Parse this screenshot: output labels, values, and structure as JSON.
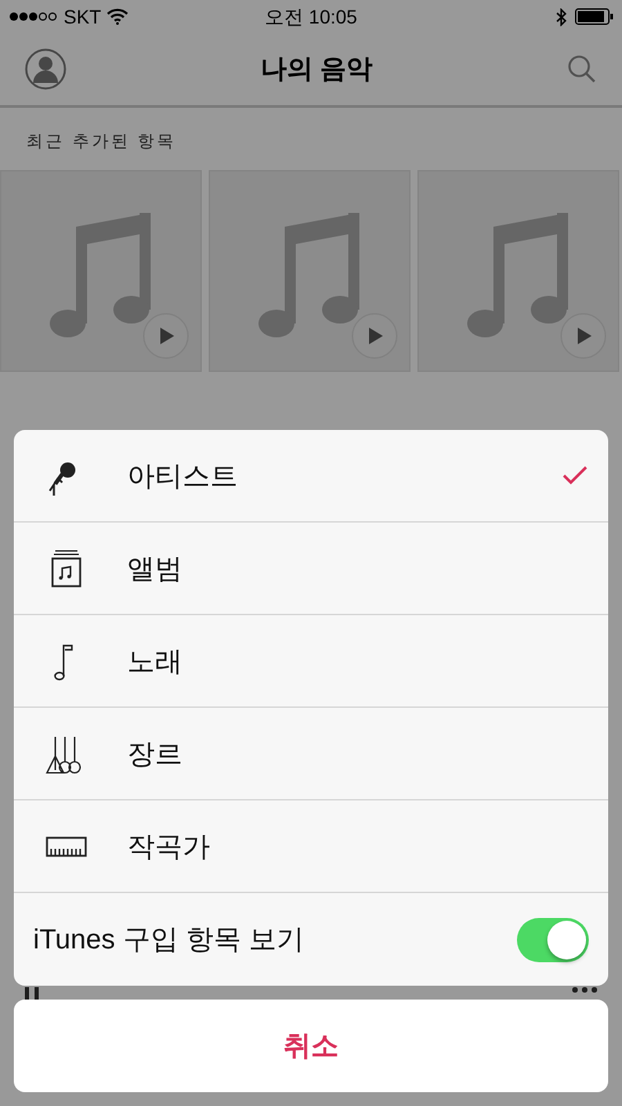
{
  "status_bar": {
    "carrier": "SKT",
    "time": "오전 10:05"
  },
  "nav_bar": {
    "title": "나의 음악"
  },
  "recent": {
    "title": "최근 추가된 항목",
    "tiles": [
      {
        "kind": "placeholder"
      },
      {
        "kind": "placeholder"
      },
      {
        "kind": "placeholder"
      }
    ]
  },
  "sheet": {
    "items": [
      {
        "kind": "artist",
        "label": "아티스트",
        "selected": true
      },
      {
        "kind": "album",
        "label": "앨범",
        "selected": false
      },
      {
        "kind": "song",
        "label": "노래",
        "selected": false
      },
      {
        "kind": "genre",
        "label": "장르",
        "selected": false
      },
      {
        "kind": "composer",
        "label": "작곡가",
        "selected": false
      }
    ],
    "toggle": {
      "label": "iTunes 구입 항목 보기",
      "on": true
    },
    "cancel": "취소"
  }
}
